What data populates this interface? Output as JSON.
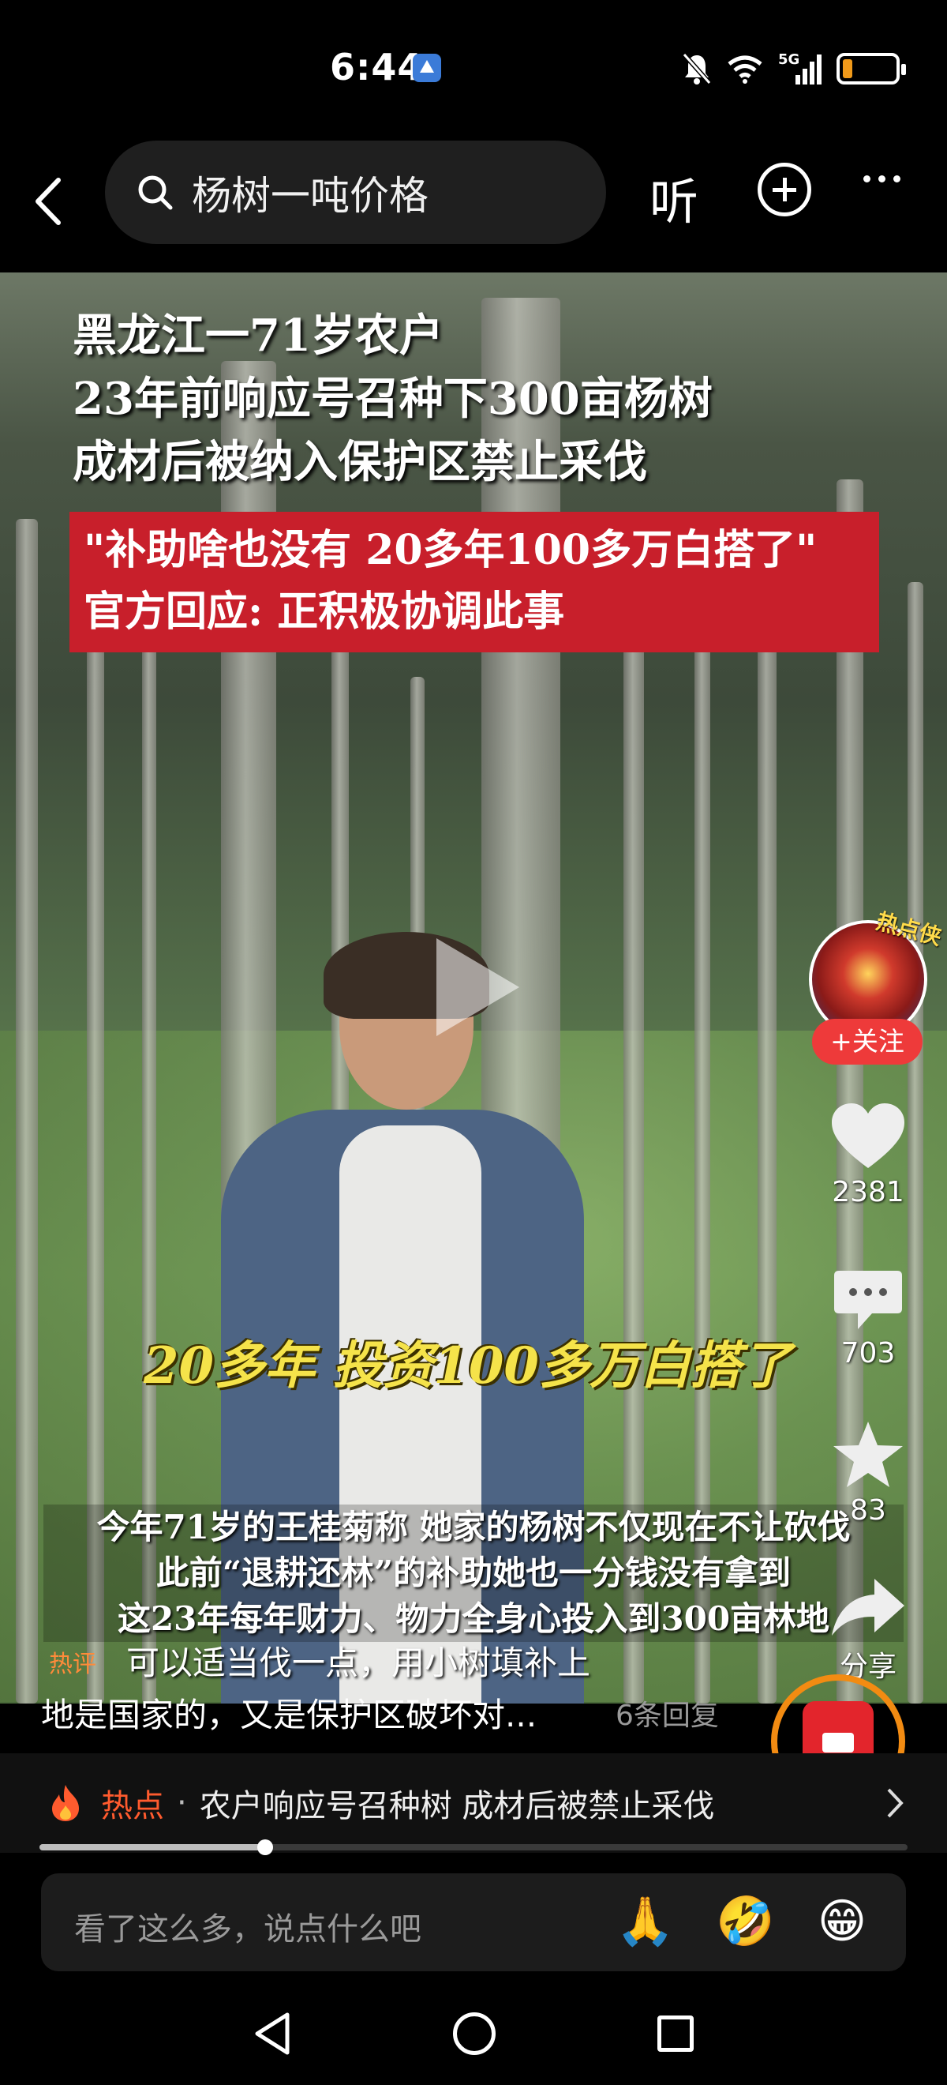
{
  "status_bar": {
    "time": "6:44",
    "network": "5G",
    "battery_color": "#f19a1a",
    "icons": [
      "app-icon",
      "bell-muted-icon",
      "wifi-icon",
      "signal-icon",
      "battery-icon"
    ]
  },
  "top_bar": {
    "search_text": "杨树一吨价格",
    "listen_label": "听"
  },
  "video": {
    "headline": [
      "黑龙江一71岁农户",
      "23年前响应号召种下300亩杨树",
      "成材后被纳入保护区禁止采伐"
    ],
    "quote": [
      "\"补助啥也没有 20多年100多万白搭了\"",
      "官方回应: 正积极协调此事"
    ],
    "caption": "20多年 投资100多万白搭了",
    "subtitles": [
      "今年71岁的王桂菊称 她家的杨树不仅现在不让砍伐",
      "此前“退耕还林”的补助她也一分钱没有拿到",
      "这23年每年财力、物力全身心投入到300亩林地"
    ]
  },
  "rail": {
    "follow_label": "+关注",
    "avatar_badge": "热点侠",
    "likes": "2381",
    "comments": "703",
    "favorites": "83",
    "share_label": "分享"
  },
  "hot_comment": {
    "tag": "热评",
    "line1": "可以适当伐一点，用小树填补上",
    "line2": "地是国家的，又是保护区破坏对...",
    "replies": "6条回复"
  },
  "topic": {
    "label": "热点",
    "separator": "·",
    "text": "农户响应号召种树 成材后被禁止采伐"
  },
  "progress": {
    "fraction": 0.26
  },
  "input": {
    "placeholder": "看了这么多，说点什么吧",
    "emojis": [
      "🙏",
      "🤣",
      "😁"
    ]
  },
  "colors": {
    "accent_red": "#ee3a3a",
    "hot_orange": "#ff5b2e",
    "quote_red": "#c81f2b",
    "caption_yellow": "#f5e34a"
  }
}
